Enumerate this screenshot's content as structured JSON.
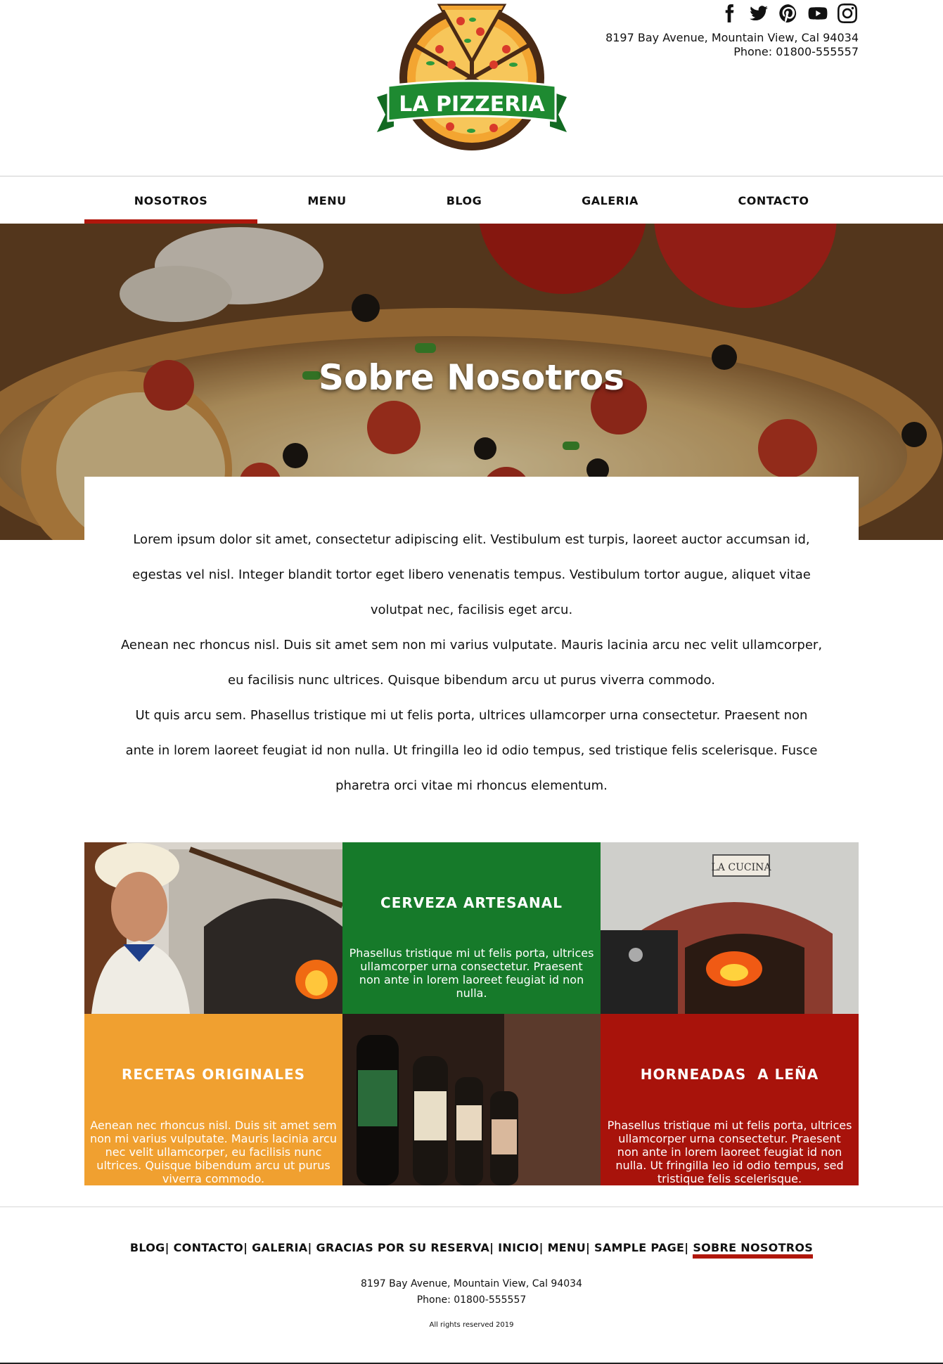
{
  "brand": {
    "logo_text": "LA PIZZERIA",
    "colors": {
      "red": "#b0170c",
      "green": "#167a2a",
      "orange": "#f0a030",
      "dark": "#111111"
    }
  },
  "header": {
    "address": "8197 Bay Avenue, Mountain View, Cal 94034",
    "phone": "Phone: 01800-555557",
    "social": [
      "facebook-icon",
      "twitter-icon",
      "pinterest-icon",
      "youtube-icon",
      "instagram-icon"
    ]
  },
  "nav": {
    "items": [
      "NOSOTROS",
      "MENU",
      "BLOG",
      "GALERIA",
      "CONTACTO"
    ],
    "active": "NOSOTROS"
  },
  "hero": {
    "title": "Sobre Nosotros"
  },
  "about": {
    "paragraphs": [
      "Lorem ipsum dolor sit amet, consectetur adipiscing elit. Vestibulum est turpis, laoreet auctor accumsan id, egestas vel nisl. Integer blandit tortor eget libero venenatis tempus. Vestibulum tortor augue, aliquet vitae volutpat nec, facilisis eget arcu.",
      "Aenean nec rhoncus nisl. Duis sit amet sem non mi varius vulputate. Mauris lacinia arcu nec velit ullamcorper, eu facilisis nunc ultrices. Quisque bibendum arcu ut purus viverra commodo.",
      "Ut quis arcu sem. Phasellus tristique mi ut felis porta, ultrices ullamcorper urna consectetur. Praesent non ante in lorem laoreet feugiat id non nulla. Ut fringilla leo id odio tempus, sed tristique felis scelerisque. Fusce pharetra orci vitae mi rhoncus elementum."
    ]
  },
  "features": [
    {
      "kind": "image",
      "name": "chef-photo"
    },
    {
      "kind": "text",
      "title": "CERVEZA ARTESANAL",
      "body": "Phasellus tristique mi ut felis porta, ultrices ullamcorper urna consectetur. Praesent non ante in lorem laoreet feugiat id non nulla.",
      "color": "#167a2a"
    },
    {
      "kind": "image",
      "name": "oven-photo",
      "sign": "LA CUCINA"
    },
    {
      "kind": "text",
      "title": "RECETAS ORIGINALES",
      "body": "Aenean nec rhoncus nisl. Duis sit amet sem non mi varius vulputate. Mauris lacinia arcu nec velit ullamcorper, eu facilisis nunc ultrices. Quisque bibendum arcu ut purus viverra commodo.",
      "color": "#f0a030"
    },
    {
      "kind": "image",
      "name": "beer-photo"
    },
    {
      "kind": "text",
      "title": "HORNEADAS  A LEÑA",
      "body": "Phasellus tristique mi ut felis porta, ultrices ullamcorper urna consectetur. Praesent non ante in lorem laoreet feugiat id non nulla. Ut fringilla leo id odio tempus, sed tristique felis scelerisque.",
      "color": "#a8130b"
    }
  ],
  "footer": {
    "links": [
      "BLOG",
      "CONTACTO",
      "GALERIA",
      "GRACIAS POR SU RESERVA",
      "INICIO",
      "MENU",
      "SAMPLE PAGE",
      "SOBRE NOSOTROS"
    ],
    "active": "SOBRE NOSOTROS",
    "address": "8197 Bay Avenue, Mountain View, Cal 94034",
    "phone": "Phone: 01800-555557",
    "rights": "All rights reserved 2019"
  }
}
